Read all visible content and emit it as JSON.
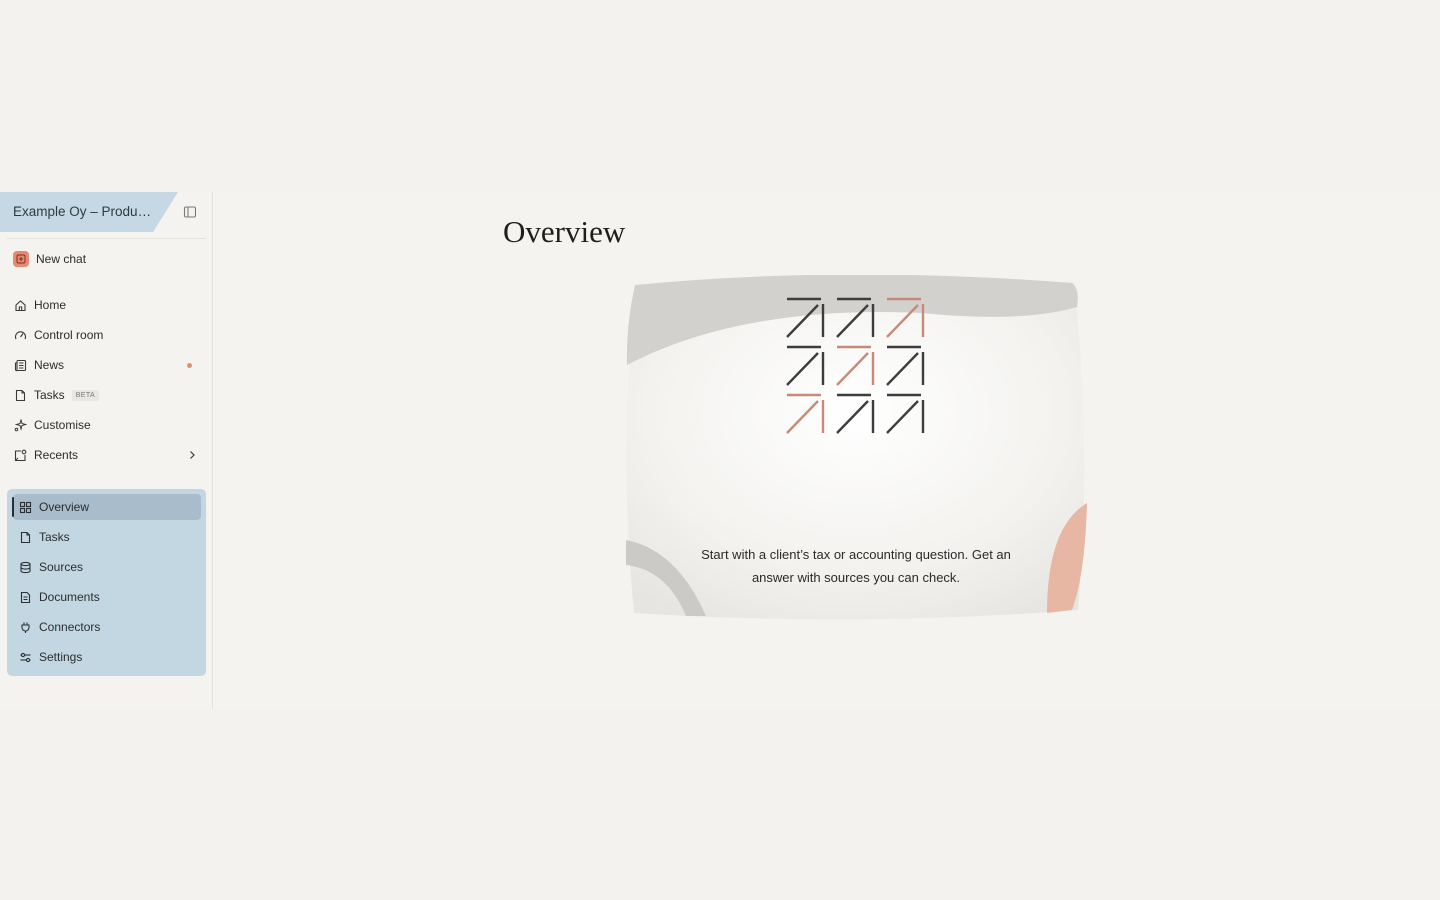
{
  "workspace": {
    "title": "Example Oy – Production",
    "collapse_icon": "sidebar-toggle-icon"
  },
  "sidebar": {
    "new_chat": {
      "label": "New chat",
      "icon": "new-chat-icon",
      "accent": "#e58a70"
    },
    "items": [
      {
        "label": "Home",
        "icon": "home-icon"
      },
      {
        "label": "Control room",
        "icon": "gauge-icon"
      },
      {
        "label": "News",
        "icon": "newspaper-icon",
        "unread_dot_color": "#e0926f"
      },
      {
        "label": "Tasks",
        "icon": "file-icon",
        "badge": "BETA"
      },
      {
        "label": "Customise",
        "icon": "sparkle-icon"
      },
      {
        "label": "Recents",
        "icon": "recents-icon",
        "chevron": "chevron-right-icon"
      }
    ],
    "project": {
      "panel_color": "#c3d7e3",
      "items": [
        {
          "label": "Overview",
          "icon": "grid-icon",
          "active": true
        },
        {
          "label": "Tasks",
          "icon": "file-icon"
        },
        {
          "label": "Sources",
          "icon": "database-icon"
        },
        {
          "label": "Documents",
          "icon": "document-icon"
        },
        {
          "label": "Connectors",
          "icon": "plug-icon"
        },
        {
          "label": "Settings",
          "icon": "sliders-icon"
        }
      ]
    }
  },
  "main": {
    "title": "Overview",
    "hero": {
      "text": "Start with a client’s tax or accounting question. Get an answer with sources you can check.",
      "illustration": "zig-zag-grid-logo",
      "accent_colors": [
        "#c78a78",
        "#e8b7a3",
        "#cccac6"
      ]
    }
  }
}
